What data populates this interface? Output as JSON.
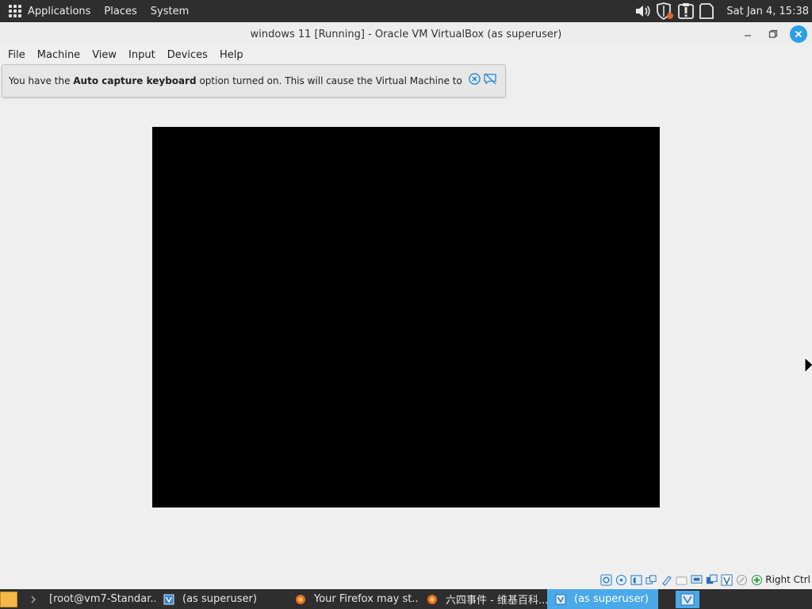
{
  "top_panel": {
    "menus": [
      "Applications",
      "Places",
      "System"
    ],
    "clock": "Sat Jan  4, 15:38"
  },
  "window": {
    "title": "windows 11 [Running] - Oracle VM VirtualBox (as superuser)"
  },
  "menubar": {
    "items": [
      "File",
      "Machine",
      "View",
      "Input",
      "Devices",
      "Help"
    ]
  },
  "notification": {
    "text_before": "You have the ",
    "text_bold": "Auto capture keyboard",
    "text_after": " option turned on. This will cause the Virtual Machine to"
  },
  "statusbar": {
    "host_key": "Right Ctrl"
  },
  "taskbar": {
    "tasks": [
      {
        "label": "[root@vm7-Standar...",
        "icon": "terminal-icon"
      },
      {
        "label": "(as superuser)",
        "icon": "virtualbox-icon"
      },
      {
        "label": "Your Firefox may st...",
        "icon": "firefox-icon"
      },
      {
        "label": "六四事件 - 维基百科...",
        "icon": "firefox-icon"
      },
      {
        "label": "(as superuser)",
        "icon": "virtualbox-vm-icon"
      }
    ]
  },
  "colors": {
    "accent": "#4aa9e9",
    "close_button": "#2aa0e8",
    "panel": "#2e2e2e"
  }
}
